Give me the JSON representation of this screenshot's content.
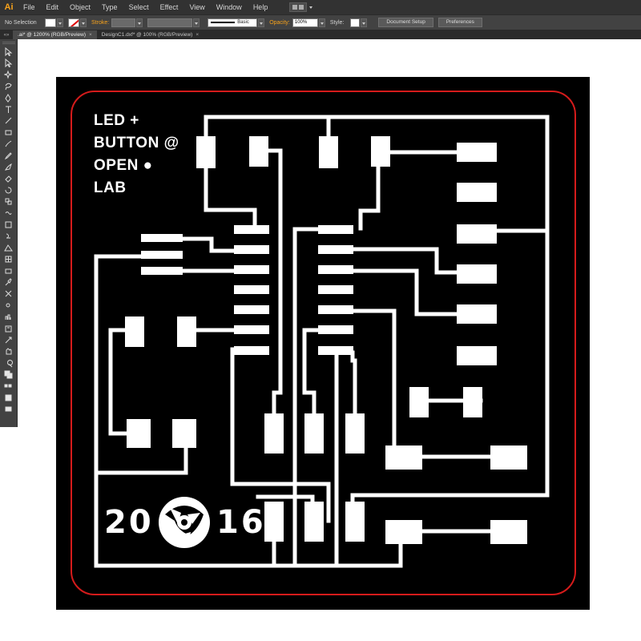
{
  "app": {
    "logo": "Ai",
    "menu": [
      "File",
      "Edit",
      "Object",
      "Type",
      "Select",
      "Effect",
      "View",
      "Window",
      "Help"
    ]
  },
  "control_bar": {
    "selection": "No Selection",
    "stroke_label": "Stroke:",
    "stroke_style": "Basic",
    "opacity_label": "Opacity:",
    "opacity_value": "100%",
    "style_label": "Style:",
    "document_setup": "Document Setup",
    "preferences": "Preferences"
  },
  "tabs": [
    {
      "label": ".ai* @ 1200% (RGB/Preview)",
      "close": "×",
      "active": true
    },
    {
      "label": "DesignC1.dxf* @ 100% (RGB/Preview)",
      "close": "×",
      "active": false
    }
  ],
  "tab_scroll": "«»",
  "pcb": {
    "title_lines": [
      "LED +",
      "BUTTON @",
      "OPEN ●",
      "LAB"
    ],
    "year_left": "20",
    "year_right": "16"
  },
  "colors": {
    "accent": "#f7a21b",
    "outline": "#d51b1b",
    "board": "#000000",
    "trace": "#ffffff"
  },
  "toolbar_icons": [
    "selection-tool-icon",
    "direct-selection-tool-icon",
    "magic-wand-icon",
    "lasso-icon",
    "pen-tool-icon",
    "type-tool-icon",
    "line-tool-icon",
    "rectangle-tool-icon",
    "paintbrush-icon",
    "pencil-icon",
    "blob-brush-icon",
    "eraser-icon",
    "rotate-tool-icon",
    "scale-tool-icon",
    "warp-tool-icon",
    "free-transform-icon",
    "shape-builder-icon",
    "perspective-grid-icon",
    "mesh-tool-icon",
    "gradient-tool-icon",
    "eyedropper-icon",
    "blend-tool-icon",
    "symbol-sprayer-icon",
    "column-graph-icon",
    "artboard-tool-icon",
    "slice-tool-icon",
    "hand-tool-icon",
    "zoom-tool-icon",
    "fill-stroke-icon",
    "color-mode-icon",
    "draw-mode-icon",
    "screen-mode-icon"
  ]
}
